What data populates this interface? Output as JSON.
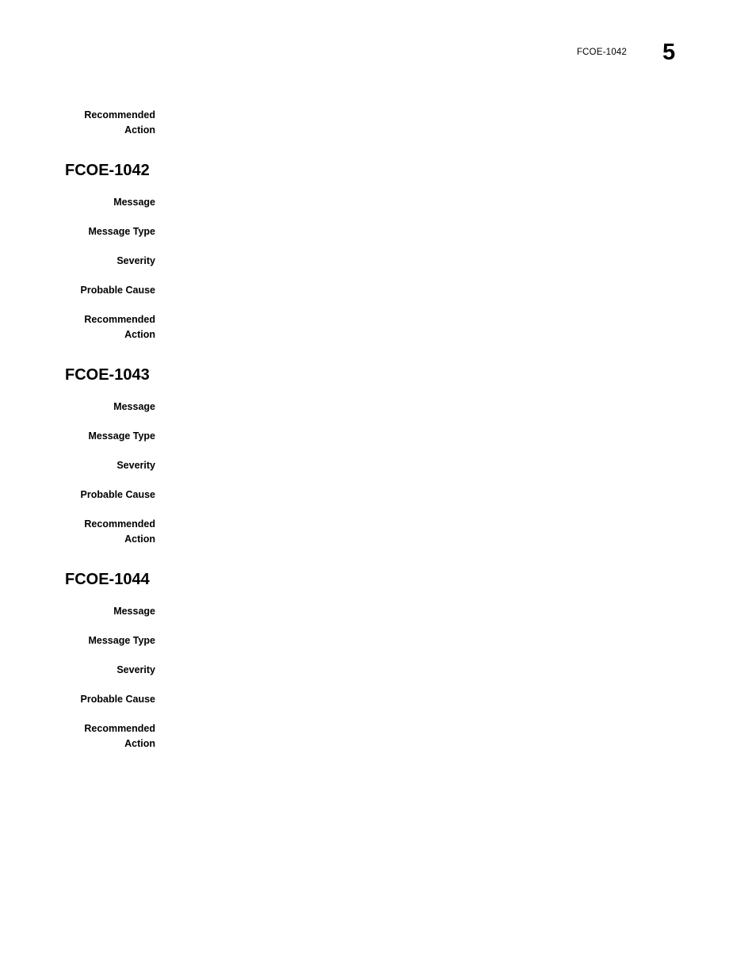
{
  "header": {
    "running_text": "FCOE-1042",
    "page_number": "5"
  },
  "labels": {
    "message": "Message",
    "message_type": "Message Type",
    "severity": "Severity",
    "probable_cause": "Probable Cause",
    "recommended_action": "Recommended\nAction"
  },
  "continued_block": {
    "recommended_action_label": "Recommended\nAction",
    "recommended_action_value": ""
  },
  "sections": [
    {
      "heading": "FCOE-1042",
      "fields": [
        {
          "label": "Message",
          "value": ""
        },
        {
          "label": "Message Type",
          "value": ""
        },
        {
          "label": "Severity",
          "value": ""
        },
        {
          "label": "Probable Cause",
          "value": ""
        },
        {
          "label": "Recommended\nAction",
          "value": ""
        }
      ]
    },
    {
      "heading": "FCOE-1043",
      "fields": [
        {
          "label": "Message",
          "value": ""
        },
        {
          "label": "Message Type",
          "value": ""
        },
        {
          "label": "Severity",
          "value": ""
        },
        {
          "label": "Probable Cause",
          "value": ""
        },
        {
          "label": "Recommended\nAction",
          "value": ""
        }
      ]
    },
    {
      "heading": "FCOE-1044",
      "fields": [
        {
          "label": "Message",
          "value": ""
        },
        {
          "label": "Message Type",
          "value": ""
        },
        {
          "label": "Severity",
          "value": ""
        },
        {
          "label": "Probable Cause",
          "value": ""
        },
        {
          "label": "Recommended\nAction",
          "value": ""
        }
      ]
    }
  ]
}
